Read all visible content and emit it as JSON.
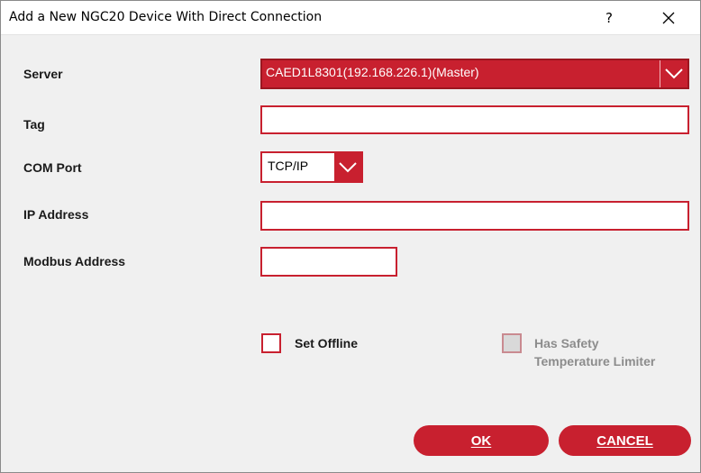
{
  "window": {
    "title": "Add a New NGC20 Device With Direct Connection"
  },
  "titlebar": {
    "help_label": "?"
  },
  "form": {
    "server_label": "Server",
    "server_value": "CAED1L8301(192.168.226.1)(Master)",
    "tag_label": "Tag",
    "tag_value": "",
    "com_port_label": "COM Port",
    "com_port_value": "TCP/IP",
    "ip_address_label": "IP Address",
    "ip_address_value": "",
    "modbus_address_label": "Modbus Address",
    "modbus_address_value": ""
  },
  "options": {
    "set_offline_label": "Set Offline",
    "set_offline_checked": false,
    "safety_limiter_label_line1": "Has Safety",
    "safety_limiter_label_line2": "Temperature Limiter",
    "safety_limiter_checked": false,
    "safety_limiter_enabled": false
  },
  "buttons": {
    "ok_label": "OK",
    "cancel_label": "CANCEL"
  },
  "colors": {
    "accent": "#c8202f",
    "disabled_text": "#8c8c8c",
    "background": "#f0f0f0"
  },
  "icons": {
    "close": "close-icon",
    "dropdown": "chevron-down-icon",
    "help": "help-icon"
  }
}
